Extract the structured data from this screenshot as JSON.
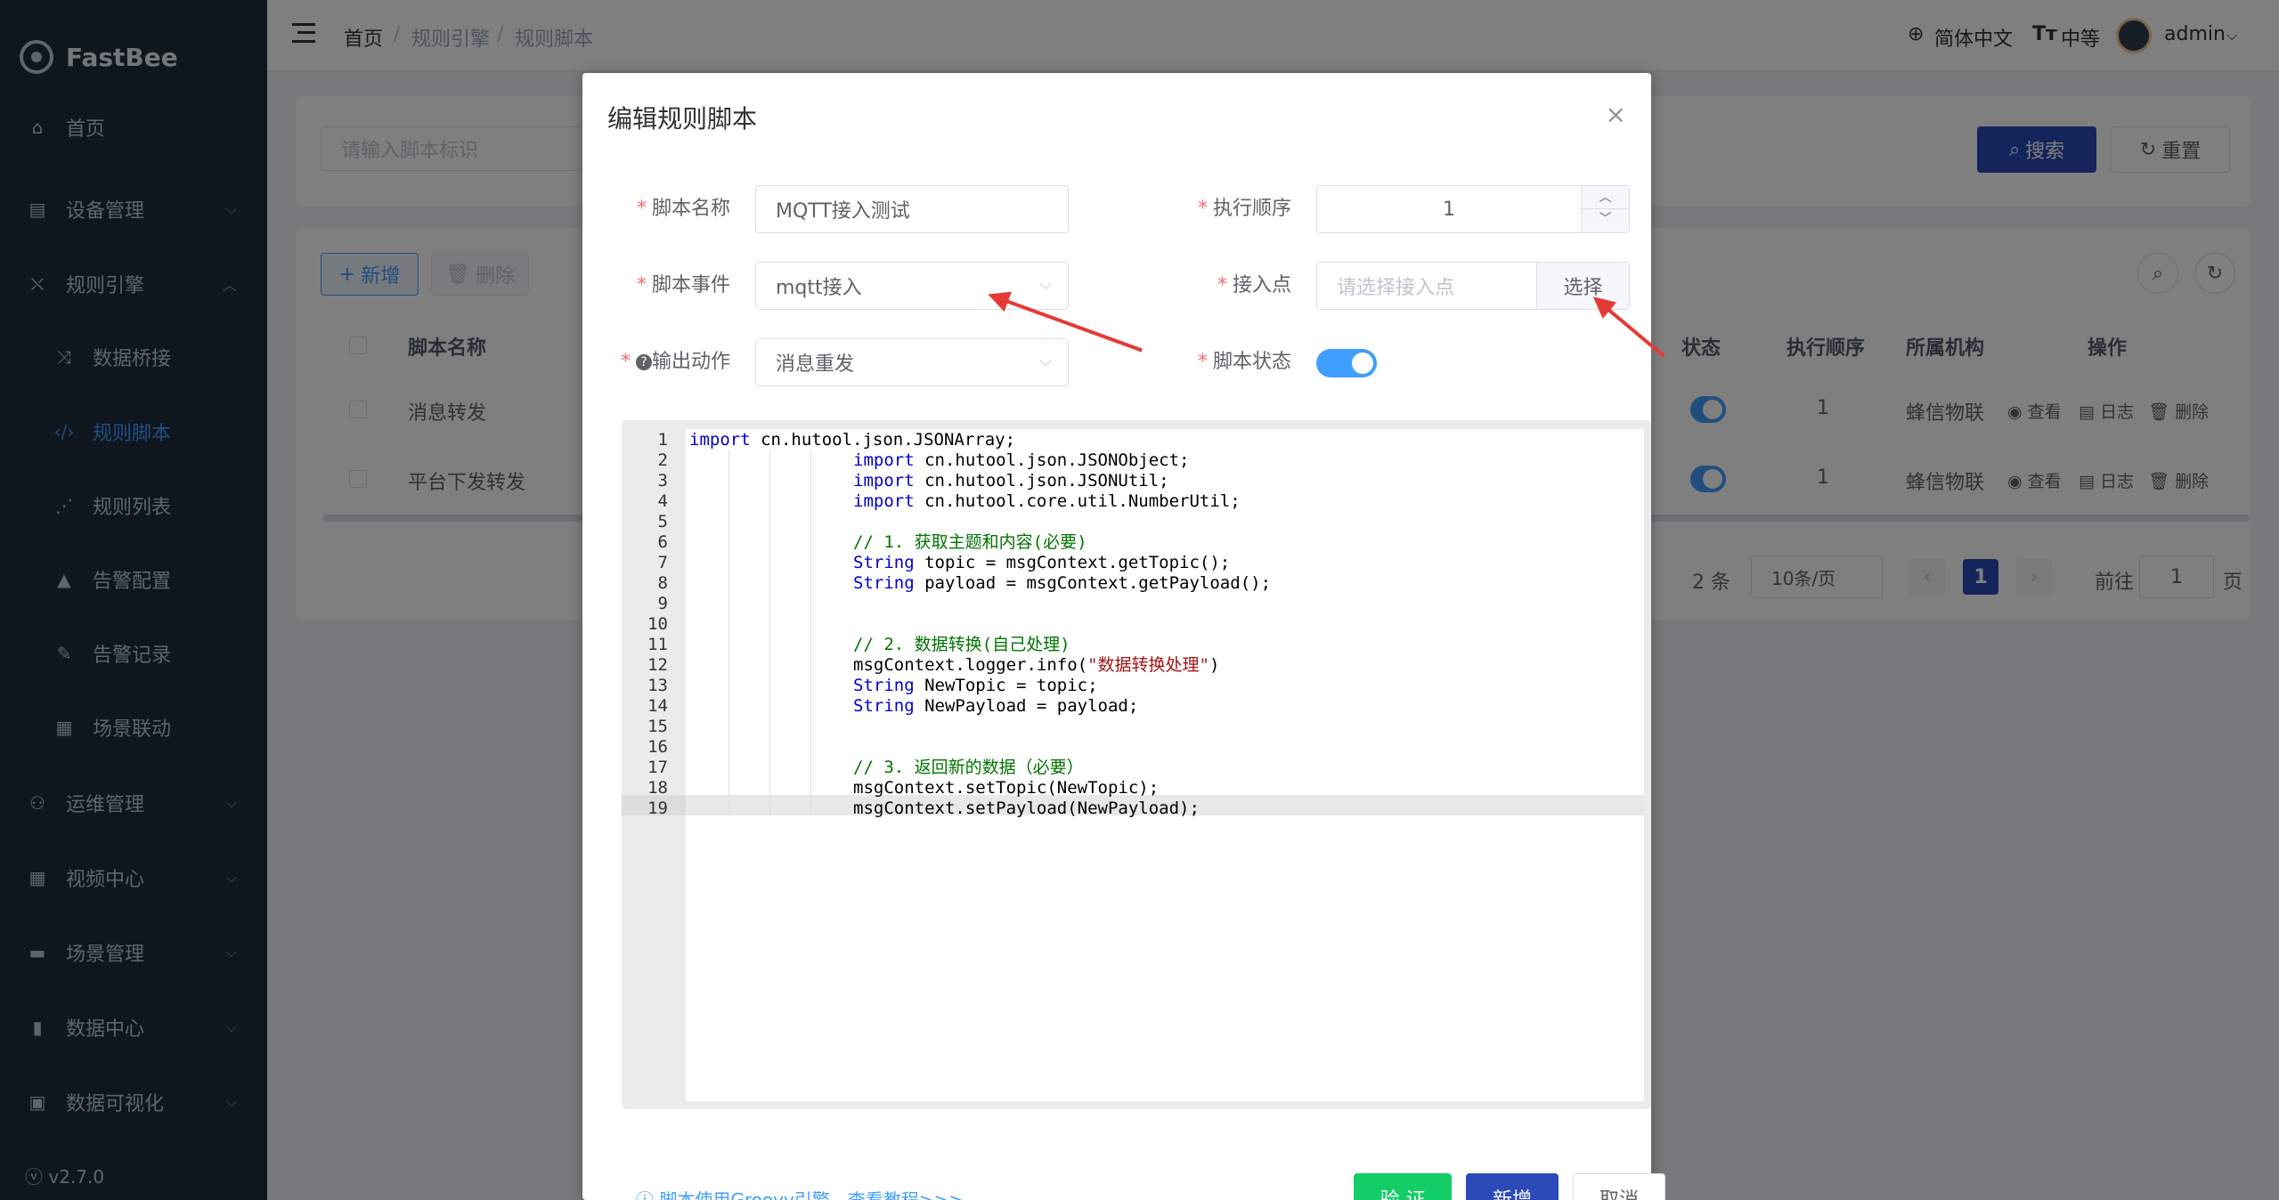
{
  "brand": {
    "name": "FastBee",
    "version": "v2.7.0"
  },
  "sidebar": {
    "items": [
      {
        "label": "首页",
        "icon": "home-icon"
      },
      {
        "label": "设备管理",
        "icon": "device-icon"
      },
      {
        "label": "规则引擎",
        "icon": "rule-engine-icon"
      },
      {
        "label": "数据桥接",
        "icon": "bridge-icon"
      },
      {
        "label": "规则脚本",
        "icon": "code-icon"
      },
      {
        "label": "规则列表",
        "icon": "rule-list-icon"
      },
      {
        "label": "告警配置",
        "icon": "alarm-icon"
      },
      {
        "label": "告警记录",
        "icon": "record-icon"
      },
      {
        "label": "场景联动",
        "icon": "scene-icon"
      },
      {
        "label": "运维管理",
        "icon": "ops-icon"
      },
      {
        "label": "视频中心",
        "icon": "video-icon"
      },
      {
        "label": "场景管理",
        "icon": "scene-mgmt-icon"
      },
      {
        "label": "数据中心",
        "icon": "data-center-icon"
      },
      {
        "label": "数据可视化",
        "icon": "visualization-icon"
      }
    ]
  },
  "header": {
    "breadcrumb": [
      "首页",
      "规则引擎",
      "规则脚本"
    ],
    "lang": "简体中文",
    "size": "中等",
    "user": "admin"
  },
  "search": {
    "placeholder": "请输入脚本标识",
    "search_label": "搜索",
    "reset_label": "重置"
  },
  "toolbar": {
    "add_label": "新增",
    "delete_label": "删除"
  },
  "table": {
    "columns": [
      "脚本名称",
      "状态",
      "执行顺序",
      "所属机构",
      "操作"
    ],
    "rows": [
      {
        "name": "消息转发",
        "order": "1",
        "org": "蜂信物联"
      },
      {
        "name": "平台下发转发",
        "order": "1",
        "org": "蜂信物联"
      }
    ],
    "actions": [
      "查看",
      "日志",
      "删除"
    ]
  },
  "pagination": {
    "total_suffix": "2 条",
    "page_size": "10条/页",
    "current": "1",
    "goto_label": "前往",
    "goto_value": "1",
    "page_unit": "页"
  },
  "dialog": {
    "title": "编辑规则脚本",
    "fields": {
      "script_name_label": "脚本名称",
      "script_name_value": "MQTT接入测试",
      "exec_order_label": "执行顺序",
      "exec_order_value": "1",
      "script_event_label": "脚本事件",
      "script_event_value": "mqtt接入",
      "access_point_label": "接入点",
      "access_point_placeholder": "请选择接入点",
      "select_label": "选择",
      "output_action_label": "输出动作",
      "output_action_value": "消息重发",
      "script_status_label": "脚本状态"
    },
    "code_lines": [
      "import cn.hutool.json.JSONArray;",
      "import cn.hutool.json.JSONObject;",
      "import cn.hutool.json.JSONUtil;",
      "import cn.hutool.core.util.NumberUtil;",
      "",
      "// 1. 获取主题和内容(必要)",
      "String topic = msgContext.getTopic();",
      "String payload = msgContext.getPayload();",
      "",
      "",
      "// 2. 数据转换(自己处理)",
      "msgContext.logger.info(\"数据转换处理\")",
      "String NewTopic = topic;",
      "String NewPayload = payload;",
      "",
      "",
      "// 3. 返回新的数据（必要）",
      "msgContext.setTopic(NewTopic);",
      "msgContext.setPayload(NewPayload);"
    ],
    "footer": {
      "link": "脚本使用Groovy引擎，查看教程>>>",
      "validate_label": "验 证",
      "submit_label": "新增",
      "cancel_label": "取消"
    }
  },
  "colors": {
    "sidebar_bg": "#1f2d3d",
    "primary": "#409eff",
    "search_btn": "#2b4ab8",
    "validate_btn": "#13ce66",
    "annotation_arrow": "#e53935"
  }
}
